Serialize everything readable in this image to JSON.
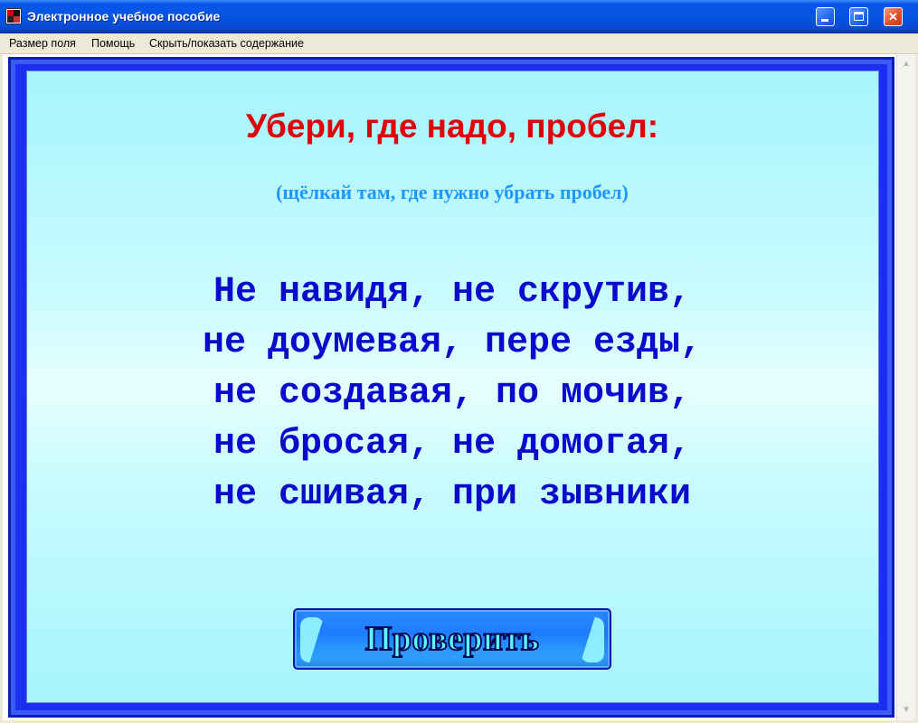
{
  "window": {
    "title": "Электронное учебное пособие"
  },
  "menu": {
    "items": [
      "Размер поля",
      "Помощь",
      "Скрыть/показать содержание"
    ]
  },
  "exercise": {
    "heading": "Убери, где надо, пробел:",
    "instruction": "(щёлкай там, где нужно убрать пробел)",
    "lines": [
      "Не навидя, не скрутив,",
      "не доумевая, пере езды,",
      "не создавая, по мочив,",
      "не бросая, не домогая,",
      "не сшивая, при зывники"
    ],
    "check_button": "Проверить"
  }
}
